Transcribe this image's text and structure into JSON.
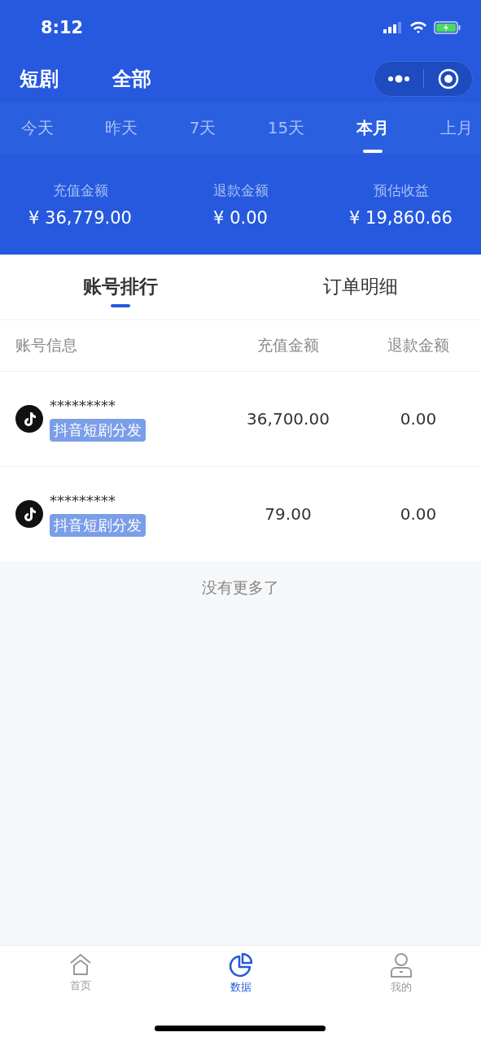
{
  "status_bar": {
    "time": "8:12"
  },
  "header": {
    "title": "短剧",
    "filter": "全部"
  },
  "period_tabs": [
    {
      "label": "今天",
      "selected": false
    },
    {
      "label": "昨天",
      "selected": false
    },
    {
      "label": "7天",
      "selected": false
    },
    {
      "label": "15天",
      "selected": false
    },
    {
      "label": "本月",
      "selected": true
    },
    {
      "label": "上月",
      "selected": false
    }
  ],
  "summary": [
    {
      "label": "充值金额",
      "value": "¥ 36,779.00"
    },
    {
      "label": "退款金额",
      "value": "¥ 0.00"
    },
    {
      "label": "预估收益",
      "value": "¥ 19,860.66"
    }
  ],
  "sub_tabs": [
    {
      "label": "账号排行",
      "selected": true
    },
    {
      "label": "订单明细",
      "selected": false
    }
  ],
  "table": {
    "columns": [
      "账号信息",
      "充值金额",
      "退款金额"
    ],
    "rows": [
      {
        "account": "*********",
        "tag": "抖音短剧分发",
        "recharge": "36,700.00",
        "refund": "0.00"
      },
      {
        "account": "*********",
        "tag": "抖音短剧分发",
        "recharge": "79.00",
        "refund": "0.00"
      }
    ]
  },
  "end_note": "没有更多了",
  "bottom_nav": [
    {
      "label": "首页",
      "kind": "home",
      "selected": false
    },
    {
      "label": "数据",
      "kind": "chart",
      "selected": true
    },
    {
      "label": "我的",
      "kind": "user",
      "selected": false
    }
  ]
}
